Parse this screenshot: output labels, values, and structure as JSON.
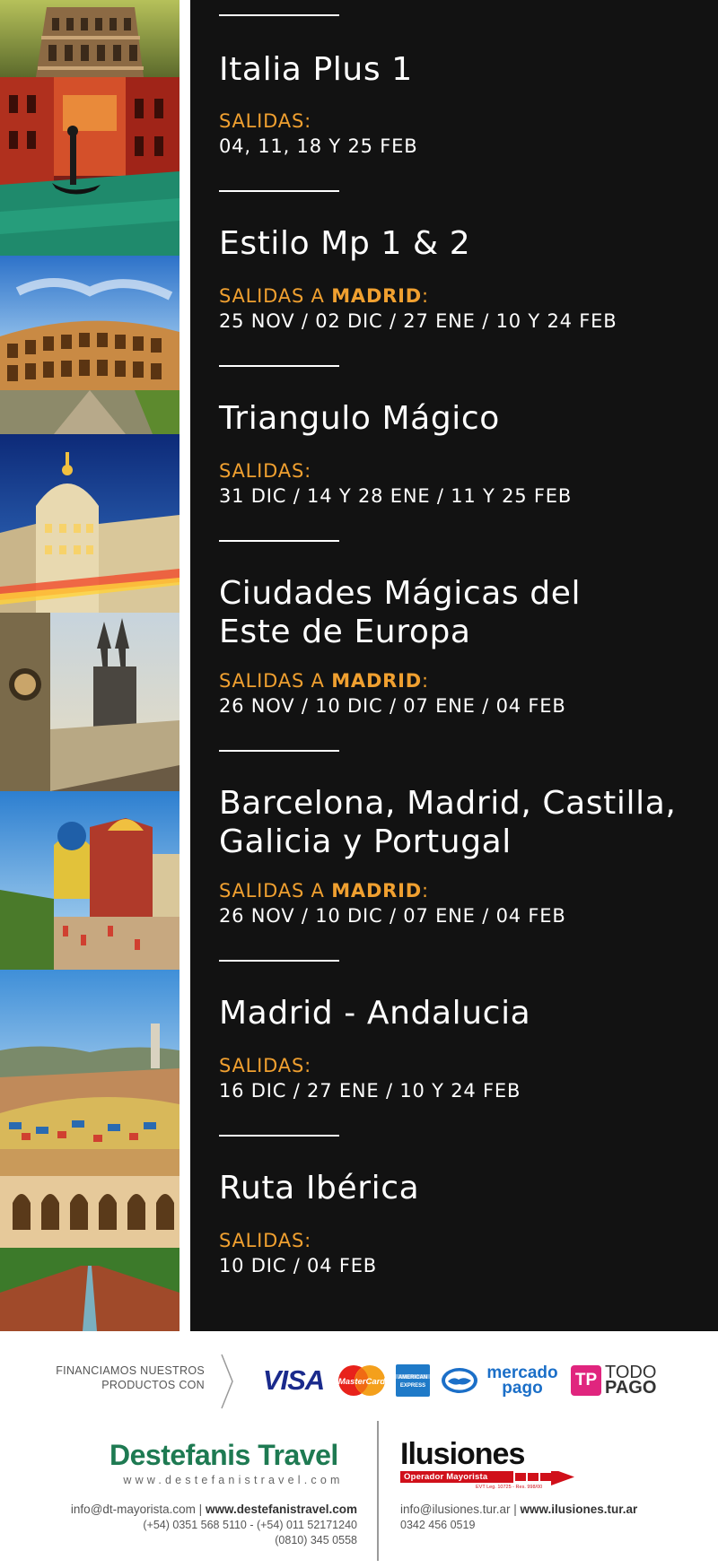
{
  "tours": [
    {
      "name_lines": [
        "Italia Plus 1"
      ],
      "departure_prefix": "SALIDAS",
      "departure_city": "",
      "departure_suffix": ":",
      "dates": "04, 11, 18 Y 25 FEB"
    },
    {
      "name_lines": [
        "Estilo Mp 1 & 2"
      ],
      "departure_prefix": "SALIDAS A ",
      "departure_city": "MADRID",
      "departure_suffix": ":",
      "dates": "25 NOV / 02 DIC / 27 ENE / 10 Y 24 FEB"
    },
    {
      "name_lines": [
        "Triangulo Mágico"
      ],
      "departure_prefix": "SALIDAS",
      "departure_city": "",
      "departure_suffix": ":",
      "dates": "31 DIC / 14 Y 28 ENE / 11 Y 25 FEB"
    },
    {
      "name_lines": [
        "Ciudades Mágicas del",
        "Este de Europa"
      ],
      "departure_prefix": "SALIDAS A ",
      "departure_city": "MADRID",
      "departure_suffix": ":",
      "dates": "26 NOV / 10 DIC / 07 ENE / 04 FEB"
    },
    {
      "name_lines": [
        "Barcelona, Madrid, Castilla,",
        "Galicia y Portugal"
      ],
      "departure_prefix": "SALIDAS A ",
      "departure_city": "MADRID",
      "departure_suffix": ":",
      "dates": "26 NOV / 10 DIC / 07 ENE / 04 FEB"
    },
    {
      "name_lines": [
        "Madrid - Andalucia"
      ],
      "departure_prefix": "SALIDAS",
      "departure_city": "",
      "departure_suffix": ":",
      "dates": "16 DIC / 27 ENE / 10 Y 24 FEB"
    },
    {
      "name_lines": [
        "Ruta Ibérica"
      ],
      "departure_prefix": "SALIDAS",
      "departure_city": "",
      "departure_suffix": ":",
      "dates": "10 DIC / 04 FEB"
    }
  ],
  "photos": [
    "leaning-tower-photo",
    "venice-canal-photo",
    "colosseum-photo",
    "madrid-metropolis-photo",
    "prague-old-town-photo",
    "pena-palace-photo",
    "park-guell-photo",
    "alcazar-sevilla-photo"
  ],
  "colors": {
    "accent": "#f0a030",
    "panel": "#121212",
    "dt_green": "#1e7a52",
    "il_red": "#d0101a",
    "mp_blue": "#1b6fc8",
    "tp_pink": "#e0257e"
  },
  "footer": {
    "financing_text_lines": [
      "FINANCIAMOS NUESTROS",
      "PRODUCTOS CON"
    ],
    "payment_logos": {
      "visa": "VISA",
      "mastercard": "MasterCard",
      "amex_line1": "AMERICAN",
      "amex_line2": "EXPRESS",
      "mercadopago_line1": "mercado",
      "mercadopago_line2": "pago",
      "todopago_mark": "TP",
      "todopago_line1": "TODO",
      "todopago_line2": "PAGO"
    },
    "destefanis": {
      "name": "Destefanis Travel",
      "web_small": "www.destefanistravel.com",
      "email": "info@dt-mayorista.com",
      "sep": " | ",
      "web": "www.destefanistravel.com",
      "phones": "(+54) 0351 568 5110 - (+54) 011 52171240",
      "phone2": "(0810) 345 0558"
    },
    "ilusiones": {
      "name": "Ilusiones",
      "tagline": "Operador Mayorista",
      "legajo": "EVT Leg. 10725 - Res. 998/00",
      "email": "info@ilusiones.tur.ar",
      "sep": " | ",
      "web": "www.ilusiones.tur.ar",
      "phone": "0342 456 0519"
    }
  }
}
